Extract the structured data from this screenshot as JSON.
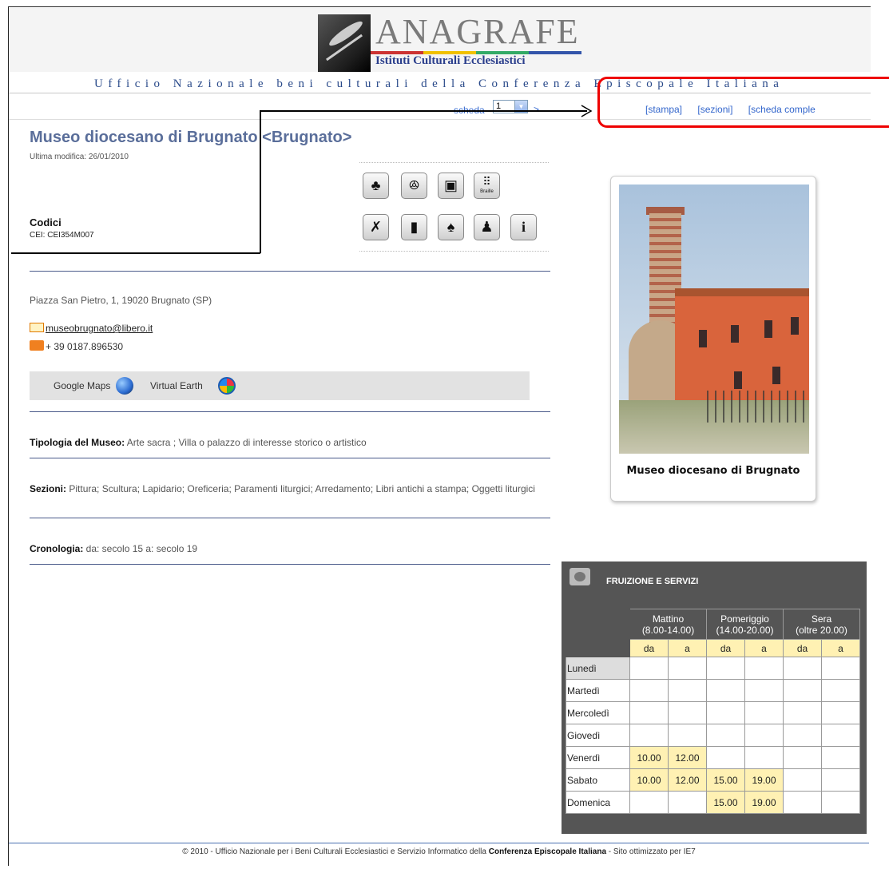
{
  "header": {
    "logo_title": "ANAGRAFE",
    "logo_subtitle": "Istituti Culturali Ecclesiastici",
    "ufficio": "Ufficio Nazionale beni culturali della Conferenza Episcopale Italiana"
  },
  "toolbar": {
    "scheda_label": "scheda",
    "scheda_value": "1",
    "next_label": ">",
    "links": [
      "[stampa]",
      "[sezioni]",
      "[scheda comple"
    ]
  },
  "museum": {
    "title": "Museo diocesano di Brugnato <Brugnato>",
    "last_modified": "Ultima modifica: 26/01/2010",
    "codici_label": "Codici",
    "codici_value": "CEI: CEI354M007",
    "address": "Piazza San Pietro, 1,  19020 Brugnato (SP)",
    "email": "museobrugnato@libero.it",
    "phone": "+ 39 0187.896530",
    "maps": {
      "google": "Google Maps",
      "virtual_earth": "Virtual Earth"
    },
    "tipologia": {
      "label": "Tipologia del Museo:",
      "value": " Arte sacra ; Villa o palazzo di interesse storico o artistico"
    },
    "sezioni": {
      "label": "Sezioni:",
      "value": " Pittura; Scultura; Lapidario; Oreficeria; Paramenti liturgici; Arredamento; Libri antichi a stampa; Oggetti liturgici"
    },
    "cronologia": {
      "label": "Cronologia:",
      "value": " da: secolo 15 a: secolo 19"
    },
    "photo_caption": "Museo diocesano di Brugnato"
  },
  "service_icons": {
    "row1": [
      "guided-tour-icon",
      "group-icon",
      "multimedia-icon",
      "braille-icon"
    ],
    "row1_glyphs": [
      "♣",
      "ꔮ",
      "▣",
      "⠿"
    ],
    "braille_text": "Braille",
    "row2": [
      "no-photo-icon",
      "book-icon",
      "restroom-icon",
      "classroom-icon",
      "info-icon"
    ],
    "row2_glyphs": [
      "✗",
      "▮",
      "♠",
      "♟",
      "i"
    ]
  },
  "fruizione": {
    "title": "FRUIZIONE E SERVIZI",
    "periods": [
      {
        "name": "Mattino",
        "range": "(8.00-14.00)"
      },
      {
        "name": "Pomeriggio",
        "range": "(14.00-20.00)"
      },
      {
        "name": "Sera",
        "range": "(oltre 20.00)"
      }
    ],
    "sub": [
      "da",
      "a",
      "da",
      "a",
      "da",
      "a"
    ],
    "days": [
      {
        "name": "Lunedì",
        "values": [
          "",
          "",
          "",
          "",
          "",
          ""
        ]
      },
      {
        "name": "Martedì",
        "values": [
          "",
          "",
          "",
          "",
          "",
          ""
        ]
      },
      {
        "name": "Mercoledì",
        "values": [
          "",
          "",
          "",
          "",
          "",
          ""
        ]
      },
      {
        "name": "Giovedì",
        "values": [
          "",
          "",
          "",
          "",
          "",
          ""
        ]
      },
      {
        "name": "Venerdì",
        "values": [
          "10.00",
          "12.00",
          "",
          "",
          "",
          ""
        ]
      },
      {
        "name": "Sabato",
        "values": [
          "10.00",
          "12.00",
          "15.00",
          "19.00",
          "",
          ""
        ]
      },
      {
        "name": "Domenica",
        "values": [
          "",
          "",
          "15.00",
          "19.00",
          "",
          ""
        ]
      }
    ]
  },
  "footer": {
    "pre": "© 2010 - Ufficio Nazionale per i Beni Culturali Ecclesiastici e Servizio Informatico della ",
    "bold": "Conferenza Episcopale Italiana",
    "post": " - Sito ottimizzato per IE7"
  },
  "colors": {
    "accent": "#3366cc",
    "title": "#5a6e9a",
    "highlight": "#fff1b3",
    "annotation": "#ee0000"
  }
}
